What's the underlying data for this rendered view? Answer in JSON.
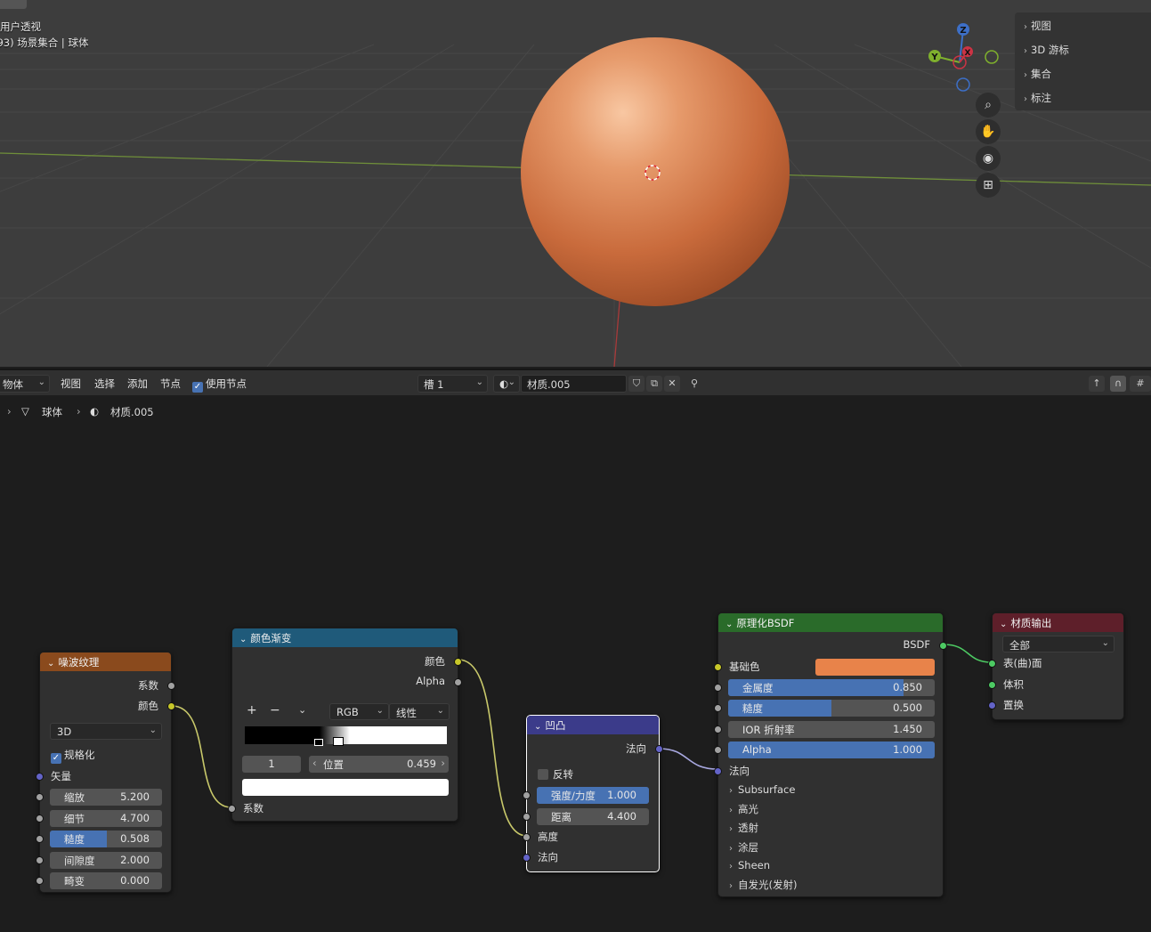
{
  "viewport": {
    "mode_line": "用户透视",
    "scene_line": "(93) 场景集合 | 球体",
    "npanel": [
      "视图",
      "3D 游标",
      "集合",
      "标注"
    ],
    "gizmo_axes": {
      "z": "Z",
      "y": "Y",
      "x": "X"
    },
    "nav_icons": [
      "zoom-icon",
      "hand-icon",
      "camera-icon",
      "grid-icon"
    ]
  },
  "header": {
    "editor_type": "物体",
    "menus": [
      "视图",
      "选择",
      "添加",
      "节点"
    ],
    "use_nodes": "使用节点",
    "slot": "槽 1",
    "material": "材质.005"
  },
  "breadcrumb": {
    "object": "球体",
    "material": "材质.005"
  },
  "nodes": {
    "noise": {
      "title": "噪波纹理",
      "outputs": [
        "系数",
        "颜色"
      ],
      "dimension": "3D",
      "normalize": "规格化",
      "vector": "矢量",
      "fields": [
        {
          "label": "缩放",
          "value": "5.200"
        },
        {
          "label": "细节",
          "value": "4.700"
        },
        {
          "label": "糙度",
          "value": "0.508",
          "fill": 0.508
        },
        {
          "label": "间隙度",
          "value": "2.000"
        },
        {
          "label": "畸变",
          "value": "0.000"
        }
      ]
    },
    "ramp": {
      "title": "颜色渐变",
      "outputs": [
        "颜色",
        "Alpha"
      ],
      "add": "+",
      "remove": "−",
      "color_mode": "RGB",
      "interpolation": "线性",
      "stop_index": "1",
      "position_label": "位置",
      "position_value": "0.459",
      "input": "系数"
    },
    "bump": {
      "title": "凹凸",
      "output": "法向",
      "invert": "反转",
      "fields": [
        {
          "label": "强度/力度",
          "value": "1.000",
          "fill": 1.0
        },
        {
          "label": "距离",
          "value": "4.400"
        }
      ],
      "inputs": [
        "高度",
        "法向"
      ]
    },
    "bsdf": {
      "title": "原理化BSDF",
      "output": "BSDF",
      "base_color_label": "基础色",
      "base_color": "#e8834a",
      "fields": [
        {
          "label": "金属度",
          "value": "0.850",
          "fill": 0.85
        },
        {
          "label": "糙度",
          "value": "0.500",
          "fill": 0.5
        },
        {
          "label": "IOR 折射率",
          "value": "1.450"
        },
        {
          "label": "Alpha",
          "value": "1.000",
          "fill": 1.0
        }
      ],
      "normal": "法向",
      "panels": [
        "Subsurface",
        "高光",
        "透射",
        "涂层",
        "Sheen",
        "自发光(发射)"
      ]
    },
    "output": {
      "title": "材质输出",
      "target": "全部",
      "inputs": [
        "表(曲)面",
        "体积",
        "置换"
      ]
    }
  },
  "colors": {
    "noise_header": "#8a4a1d",
    "ramp_header": "#1f5a7a",
    "bump_header": "#3b3b8a",
    "bsdf_header": "#2a6b2a",
    "output_header": "#5e1f2a",
    "accent": "#4772b3"
  }
}
